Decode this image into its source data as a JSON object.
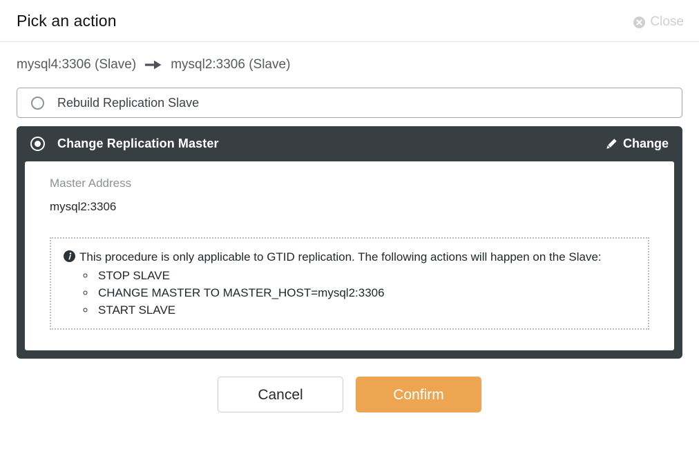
{
  "dialog": {
    "title": "Pick an action",
    "close_label": "Close",
    "close_icon": "close-circle-icon"
  },
  "path": {
    "source": "mysql4:3306 (Slave)",
    "arrow_icon": "arrow-right-icon",
    "target": "mysql2:3306 (Slave)"
  },
  "options": [
    {
      "label": "Rebuild Replication Slave",
      "selected": false
    },
    {
      "label": "Change Replication Master",
      "selected": true,
      "change_label": "Change",
      "change_icon": "pencil-icon",
      "field_label": "Master Address",
      "field_value": "mysql2:3306",
      "info": {
        "icon": "info-circle-icon",
        "text": "This procedure is only applicable to GTID replication. The following actions will happen on the Slave:",
        "items": [
          "STOP SLAVE",
          "CHANGE MASTER TO MASTER_HOST=mysql2:3306",
          "START SLAVE"
        ]
      }
    }
  ],
  "footer": {
    "cancel_label": "Cancel",
    "confirm_label": "Confirm"
  },
  "colors": {
    "panel_dark": "#373f43",
    "accent_orange": "#eda551",
    "muted_text": "#8d9296",
    "close_gray": "#cfcfcf"
  }
}
